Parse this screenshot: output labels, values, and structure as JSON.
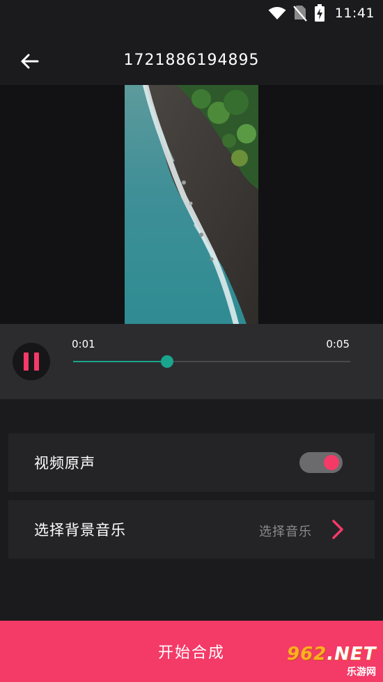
{
  "status_bar": {
    "time": "11:41",
    "icons": [
      "wifi-icon",
      "no-sim-icon",
      "battery-charging-icon"
    ]
  },
  "header": {
    "back_icon": "arrow-left-icon",
    "title": "1721886194895"
  },
  "player": {
    "state_icon": "pause-icon",
    "current_time": "0:01",
    "total_time": "0:05",
    "progress_fraction": 0.34
  },
  "settings": {
    "original_sound": {
      "label": "视频原声",
      "enabled": true
    },
    "background_music": {
      "label": "选择背景音乐",
      "value": "选择音乐",
      "icon": "chevron-right-icon"
    }
  },
  "start_button": {
    "label": "开始合成"
  },
  "watermark": {
    "main": "962.NET",
    "sub": "乐游网"
  },
  "colors": {
    "accent": "#f43a67",
    "progress": "#1aa58f",
    "background": "#1b1b1d",
    "row": "#242427",
    "player_bar": "#2c2c2e"
  }
}
